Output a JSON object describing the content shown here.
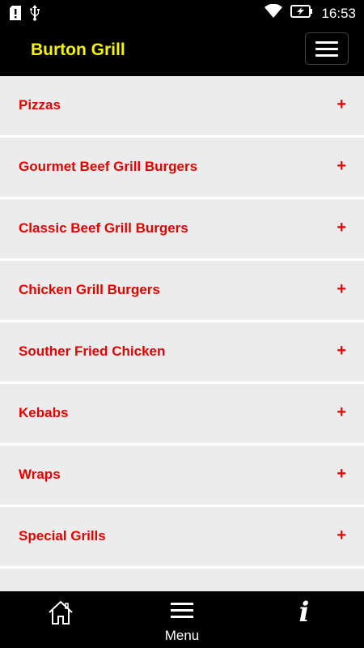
{
  "status_bar": {
    "time": "16:53",
    "icons": [
      "sim-alert-icon",
      "usb-icon",
      "wifi-icon",
      "battery-charging-icon"
    ]
  },
  "app_bar": {
    "title": "Burton Grill",
    "menu_icon": "hamburger-icon"
  },
  "menu": {
    "expand_symbol": "+",
    "items": [
      {
        "label": "Pizzas"
      },
      {
        "label": "Gourmet Beef Grill Burgers"
      },
      {
        "label": "Classic Beef Grill Burgers"
      },
      {
        "label": "Chicken Grill Burgers"
      },
      {
        "label": "Souther Fried Chicken"
      },
      {
        "label": "Kebabs"
      },
      {
        "label": "Wraps"
      },
      {
        "label": "Special Grills"
      }
    ]
  },
  "bottom_nav": {
    "home_icon": "home-icon",
    "menu_label": "Menu",
    "menu_icon": "menu-lines-icon",
    "info_icon": "info-icon",
    "info_glyph": "i"
  },
  "colors": {
    "title": "#f5f500",
    "item_text": "#e00000",
    "item_bg": "#ececec",
    "bar_bg": "#000000"
  }
}
